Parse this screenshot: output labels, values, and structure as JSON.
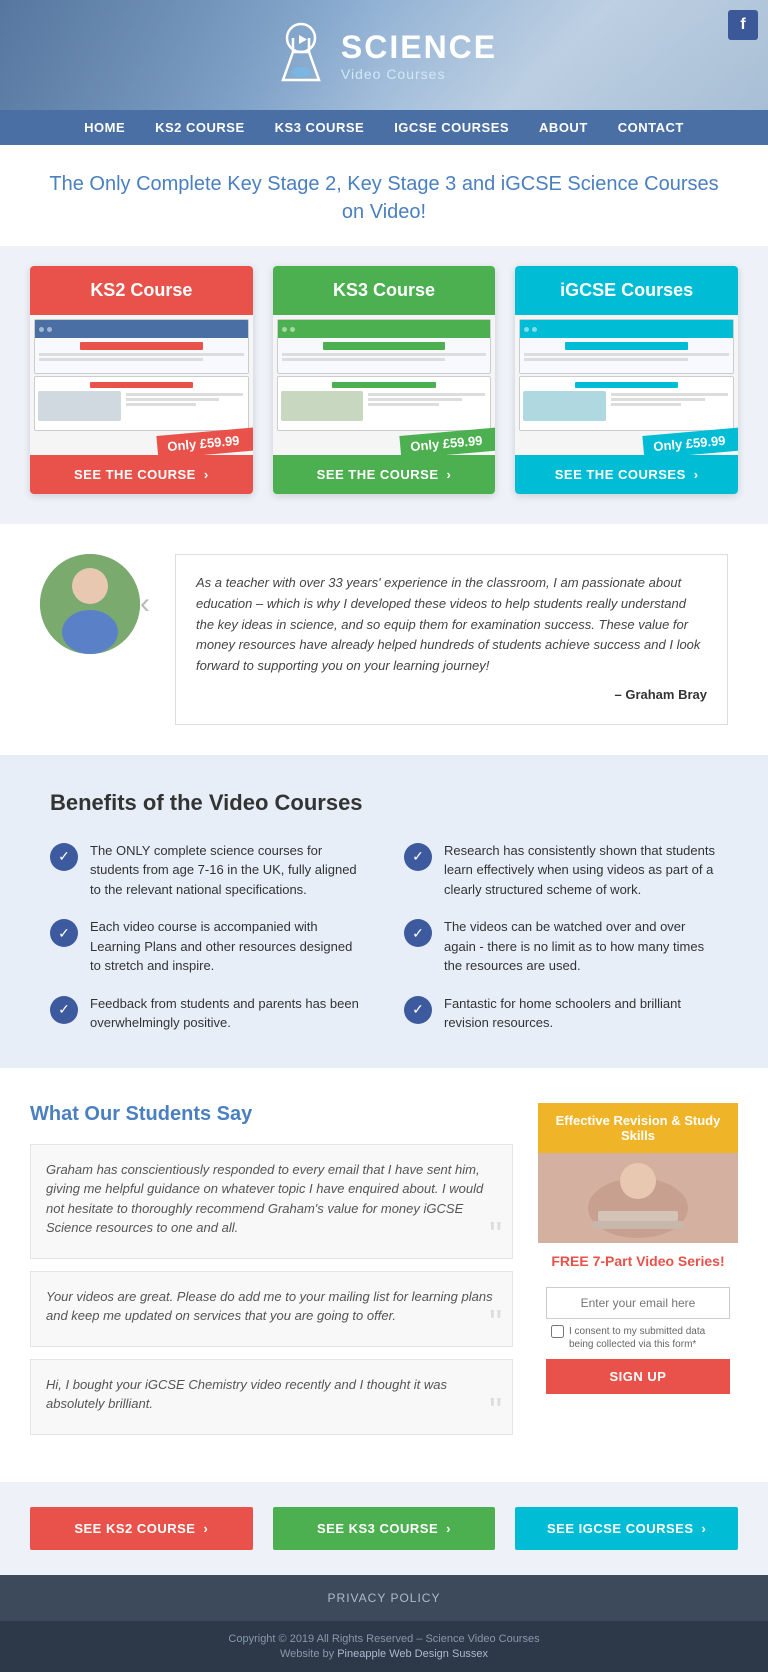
{
  "header": {
    "facebook_letter": "f",
    "logo_science": "SCIENCE",
    "logo_sub": "Video Courses"
  },
  "nav": {
    "items": [
      {
        "label": "HOME",
        "href": "#"
      },
      {
        "label": "KS2 COURSE",
        "href": "#"
      },
      {
        "label": "KS3 COURSE",
        "href": "#"
      },
      {
        "label": "IGCSE COURSES",
        "href": "#"
      },
      {
        "label": "ABOUT",
        "href": "#"
      },
      {
        "label": "CONTACT",
        "href": "#"
      }
    ]
  },
  "hero": {
    "tagline": "The Only Complete Key Stage 2, Key Stage 3 and iGCSE Science Courses on Video!"
  },
  "courses": [
    {
      "id": "ks2",
      "title": "KS2 Course",
      "price": "Only £59.99",
      "cta": "SEE THE COURSE",
      "color_class": "ks2"
    },
    {
      "id": "ks3",
      "title": "KS3 Course",
      "price": "Only £59.99",
      "cta": "SEE THE COURSE",
      "color_class": "ks3"
    },
    {
      "id": "igcse",
      "title": "iGCSE Courses",
      "price": "Only £59.99",
      "cta": "SEE THE COURSES",
      "color_class": "igcse"
    }
  ],
  "testimonial": {
    "quote": "As a teacher with over 33 years' experience in the classroom, I am passionate about education – which is why I developed these videos to help students really understand the key ideas in science, and so equip them for examination success. These value for money resources have already helped hundreds of students achieve success and I look forward to supporting you on your learning journey!",
    "author": "– Graham Bray"
  },
  "benefits": {
    "title": "Benefits of the Video Courses",
    "items": [
      "The ONLY complete science courses for students from age 7-16 in the UK, fully aligned to the relevant national specifications.",
      "Research has consistently shown that students learn effectively when using videos as part of a clearly structured scheme of work.",
      "Each video course is accompanied with Learning Plans and other resources designed to stretch and inspire.",
      "The videos can be watched over and over again - there is no limit as to how many times the resources are used.",
      "Feedback from students and parents has been overwhelmingly positive.",
      "Fantastic for home schoolers and brilliant revision resources."
    ]
  },
  "students": {
    "title": "What Our Students Say",
    "quotes": [
      "Graham has conscientiously responded to every email that I have sent him, giving me helpful guidance on whatever topic I have enquired about. I would not hesitate to thoroughly recommend Graham's value for money iGCSE Science resources to one and all.",
      "Your videos are great. Please do add me to your mailing list for learning plans and keep me updated on services that you are going to offer.",
      "Hi, I bought your iGCSE Chemistry video recently and I thought it was absolutely brilliant."
    ]
  },
  "signup": {
    "header": "Effective Revision & Study Skills",
    "free_text": "FREE 7-Part Video Series!",
    "email_placeholder": "Enter your email here",
    "consent_text": "I consent to my submitted data being collected via this form*",
    "button_label": "SIGN UP"
  },
  "bottom_cta": [
    {
      "label": "SEE KS2 COURSE",
      "color_class": "ks2"
    },
    {
      "label": "SEE KS3 COURSE",
      "color_class": "ks3"
    },
    {
      "label": "SEE IGCSE COURSES",
      "color_class": "igcse"
    }
  ],
  "footer": {
    "privacy_label": "PRIVACY POLICY",
    "copyright": "Copyright © 2019 All Rights Reserved – Science Video Courses",
    "website_credit_prefix": "Website by ",
    "website_credit_link": "Pineapple Web Design Sussex"
  }
}
